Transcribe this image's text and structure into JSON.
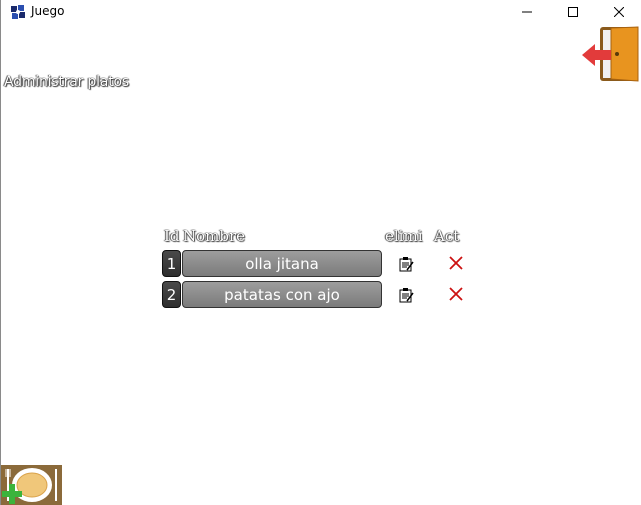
{
  "window": {
    "title": "Juego"
  },
  "page": {
    "title": "Administrar platos"
  },
  "table": {
    "headers": {
      "id": "Id",
      "name": "Nombre",
      "delete": "elimi",
      "update": "Act"
    },
    "rows": [
      {
        "id": "1",
        "name": "olla jitana"
      },
      {
        "id": "2",
        "name": "patatas con ajo"
      }
    ]
  },
  "icons": {
    "app": "app-logo-icon",
    "exit": "exit-door-icon",
    "edit": "clipboard-edit-icon",
    "delete": "red-x-icon",
    "add_dish": "add-plate-icon"
  },
  "colors": {
    "delete_x": "#cc1111",
    "door": "#e8941f",
    "arrow": "#e23b3b",
    "add_plus": "#3cb43c"
  }
}
